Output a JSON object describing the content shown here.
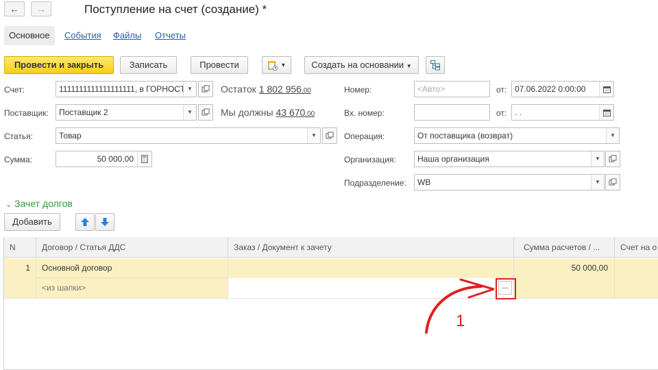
{
  "window": {
    "title": "Поступление на счет (создание) *",
    "back_icon": "arrow-left-icon",
    "forward_icon": "arrow-right-icon"
  },
  "tabs": [
    "Основное",
    "События",
    "Файлы",
    "Отчеты"
  ],
  "toolbar": {
    "post_close": "Провести и закрыть",
    "save": "Записать",
    "post": "Провести",
    "create_based_on": "Создать на основании"
  },
  "form": {
    "account_label": "Счет:",
    "account_value": "1111111111111111111, в ГОРНОСТ",
    "balance_label": "Остаток",
    "balance_value": "1 802 956",
    "balance_cents": ",00",
    "supplier_label": "Поставщик:",
    "supplier_value": "Поставщик 2",
    "owe_label": "Мы должны",
    "owe_value": "43 670",
    "owe_cents": ",00",
    "article_label": "Статья:",
    "article_value": "Товар",
    "amount_label": "Сумма:",
    "amount_value": "50 000,00",
    "number_label": "Номер:",
    "number_placeholder": "<Авто>",
    "from_label": "от:",
    "date_value": "07.06.2022  0:00:00",
    "in_number_label": "Вх. номер:",
    "in_date_value": " .  .",
    "operation_label": "Операция:",
    "operation_value": "От поставщика (возврат)",
    "org_label": "Организация:",
    "org_value": "Наша организация",
    "division_label": "Подразделение:",
    "division_value": "WB"
  },
  "debts": {
    "section_title": "Зачет долгов",
    "add_button": "Добавить",
    "columns": [
      "N",
      "Договор / Статья ДДС",
      "Заказ / Документ к зачету",
      "Сумма расчетов / ...",
      "Счет на о"
    ],
    "rows": [
      {
        "n": "1",
        "contract": "Основной договор",
        "article": "<из шапки>",
        "order": "",
        "amount": "50 000,00",
        "choose": "..."
      }
    ]
  },
  "annotation": {
    "label": "1",
    "color": "#e02020"
  },
  "colors": {
    "primary_button": "#f6cf1a",
    "link": "#2a5d9e",
    "section": "#2e9a3a",
    "row_highlight": "#fbf0c2",
    "arrow_buttons": "#2f7fd6"
  }
}
